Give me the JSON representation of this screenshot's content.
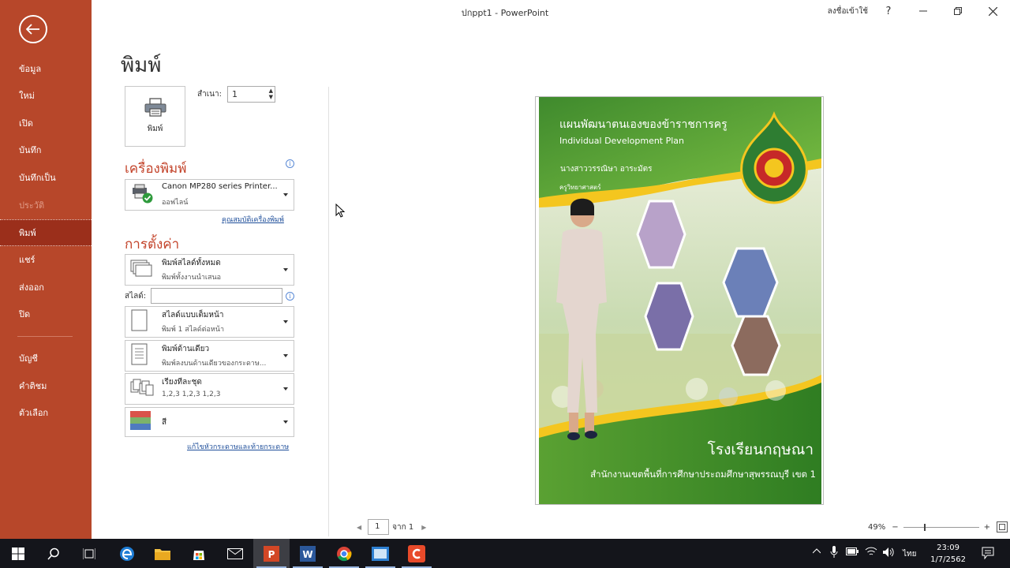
{
  "window": {
    "title": "ปกppt1  -  PowerPoint",
    "sign_in": "ลงชื่อเข้าใช้",
    "help": "?"
  },
  "sidebar": {
    "items": [
      {
        "label": "ข้อมูล"
      },
      {
        "label": "ใหม่"
      },
      {
        "label": "เปิด"
      },
      {
        "label": "บันทึก"
      },
      {
        "label": "บันทึกเป็น"
      },
      {
        "label": "ประวัติ"
      },
      {
        "label": "พิมพ์"
      },
      {
        "label": "แชร์"
      },
      {
        "label": "ส่งออก"
      },
      {
        "label": "ปิด"
      },
      {
        "label": "บัญชี"
      },
      {
        "label": "คำติชม"
      },
      {
        "label": "ตัวเลือก"
      }
    ]
  },
  "print": {
    "title": "พิมพ์",
    "button_label": "พิมพ์",
    "copies_label": "สำเนา:",
    "copies_value": "1"
  },
  "printer": {
    "section_title": "เครื่องพิมพ์",
    "name": "Canon MP280 series Printer...",
    "status": "ออฟไลน์",
    "properties_link": "คุณสมบัติเครื่องพิมพ์"
  },
  "settings": {
    "section_title": "การตั้งค่า",
    "range_main": "พิมพ์สไลด์ทั้งหมด",
    "range_sub": "พิมพ์ทั้งงานนำเสนอ",
    "slides_label": "สไลด์:",
    "slides_value": "",
    "layout_main": "สไลด์แบบเต็มหน้า",
    "layout_sub": "พิมพ์ 1 สไลด์ต่อหน้า",
    "sides_main": "พิมพ์ด้านเดียว",
    "sides_sub": "พิมพ์ลงบนด้านเดียวของกระดาษ...",
    "collate_main": "เรียงทีละชุด",
    "collate_sub": "1,2,3    1,2,3    1,2,3",
    "color_main": "สี",
    "header_footer_link": "แก้ไขหัวกระดาษและท้ายกระดาษ"
  },
  "slide": {
    "title_th": "แผนพัฒนาตนเองของข้าราชการครู",
    "title_en": "Individual Development Plan",
    "teacher_name": "นางสาววรรณิษา  อาระมัตร",
    "position": "ครูวิทยาศาสตร์",
    "school": "โรงเรียนกฤษณา",
    "office": "สำนักงานเขตพื้นที่การศึกษาประถมศึกษาสุพรรณบุรี เขต 1"
  },
  "preview_nav": {
    "page": "1",
    "of_label": "จาก 1"
  },
  "zoom": {
    "level": "49%"
  },
  "taskbar": {
    "time": "23:09",
    "date": "1/7/2562",
    "language": "ไทย"
  },
  "colors": {
    "accent": "#b7472a",
    "accent_dark": "#9b2f1b",
    "section_title": "#c3432a",
    "link": "#1e4e9a"
  }
}
